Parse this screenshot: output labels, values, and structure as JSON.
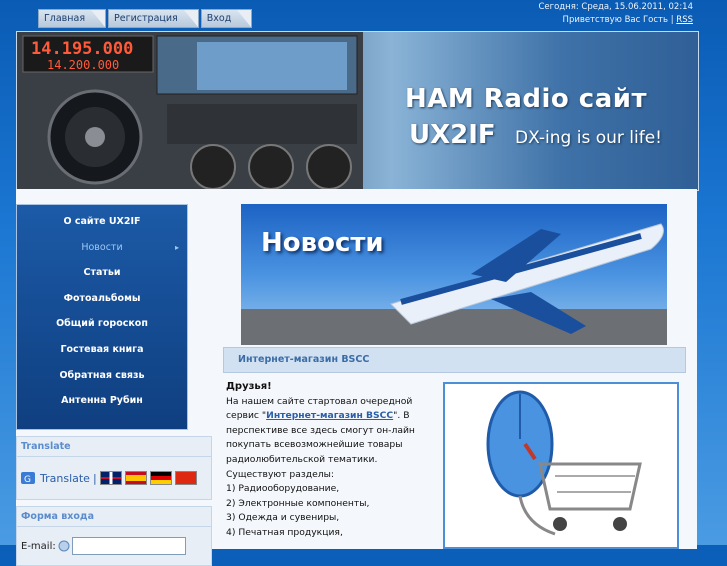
{
  "nav": {
    "items": [
      "Главная",
      "Регистрация",
      "Вход"
    ]
  },
  "topbar": {
    "date_text": "Сегодня: Среда, 15.06.2011, 02:14",
    "greeting": "Приветствую Вас Гость",
    "separator": "|",
    "rss": "RSS"
  },
  "header": {
    "title": "HAM Radio сайт",
    "callsign": "UX2IF",
    "slogan": "DX-ing is our life!",
    "freq_main": "14.195.000",
    "freq_sub": "14.200.000"
  },
  "menu": {
    "items": [
      {
        "label": "О сайте UX2IF"
      },
      {
        "label": "Новости"
      },
      {
        "label": "Статьи"
      },
      {
        "label": "Фотоальбомы"
      },
      {
        "label": "Общий гороскоп"
      },
      {
        "label": "Гостевая книга"
      },
      {
        "label": "Обратная связь"
      },
      {
        "label": "Антенна Рубин"
      }
    ]
  },
  "translate": {
    "title": "Translate",
    "link": "Translate",
    "separator": "|"
  },
  "login": {
    "title": "Форма входа",
    "email_label": "E-mail:"
  },
  "news": {
    "banner_title": "Новости"
  },
  "article": {
    "panel_title": "Интернет-магазин BSCC",
    "greeting": "Друзья!",
    "p1_a": "На нашем сайте стартовал очередной сервис \"",
    "link": "Интернет-магазин BSCC",
    "p1_b": "\". В перспективе все здесь смогут он-лайн покупать всевозможнейшие товары радиолюбительской тематики.",
    "p2": "Существуют разделы:",
    "list": [
      "1) Радиооборудование,",
      "2) Электронные компоненты,",
      "3) Одежда и сувениры,",
      "4) Печатная продукция,"
    ]
  },
  "colors": {
    "accent": "#0b5fb8",
    "menu_bg": "#1c5aa7",
    "link": "#2b5ea8"
  }
}
